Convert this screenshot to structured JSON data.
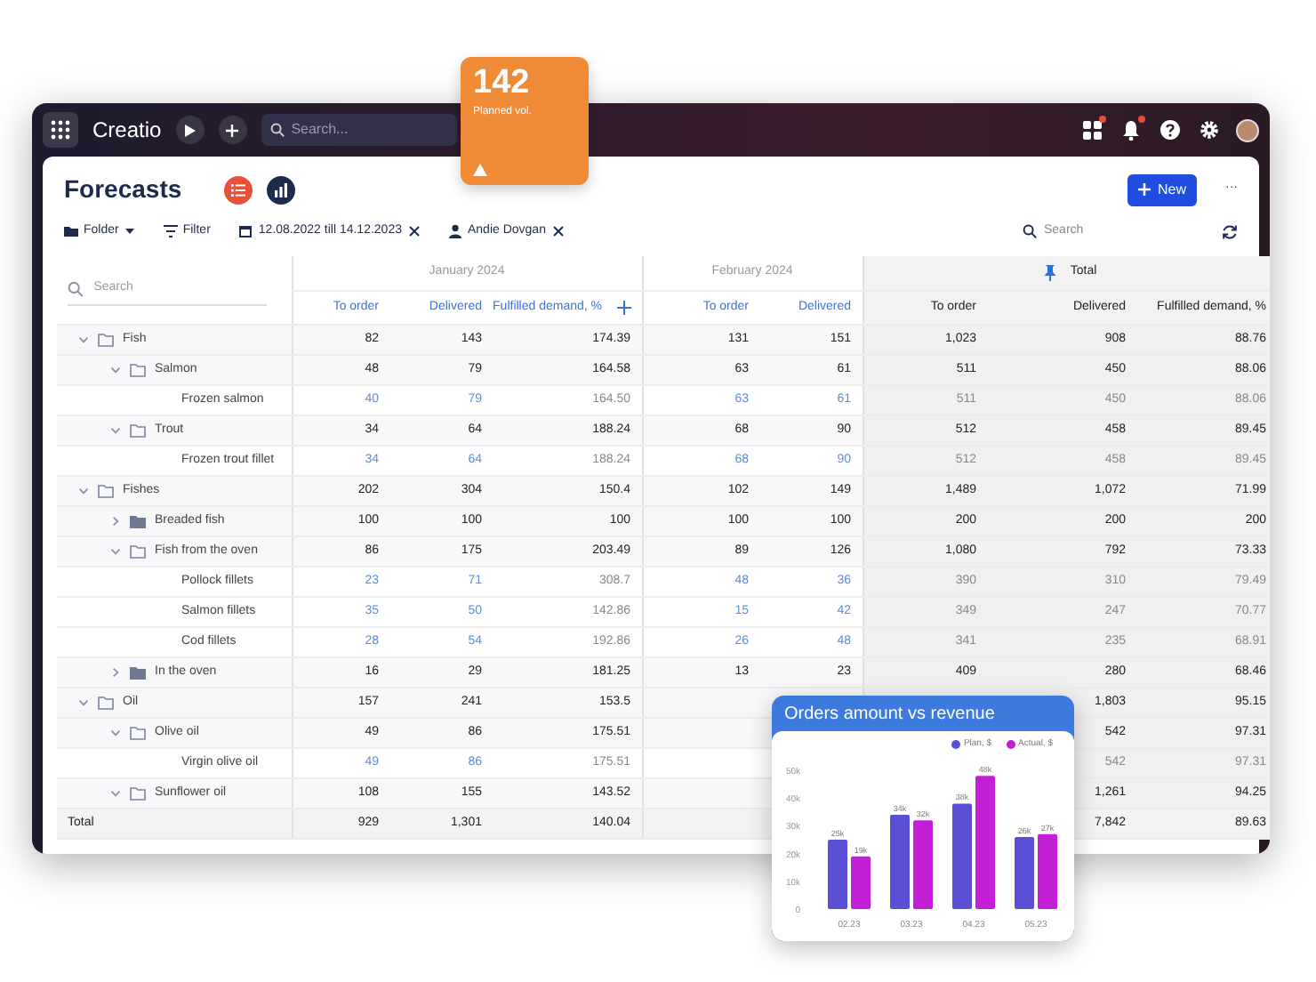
{
  "badge": {
    "value": "142",
    "label": "Planned vol."
  },
  "topbar": {
    "logo": "Creatio",
    "search_placeholder": "Search...",
    "notifications": [
      {
        "kind": "apps",
        "dot": true
      },
      {
        "kind": "bell",
        "dot": true
      },
      {
        "kind": "help",
        "dot": false
      },
      {
        "kind": "settings",
        "dot": false
      }
    ]
  },
  "header": {
    "title": "Forecasts",
    "views": [
      {
        "kind": "list",
        "selected": true
      },
      {
        "kind": "chart",
        "selected": false
      }
    ],
    "new_button": "New",
    "more": "···"
  },
  "filters": {
    "folder": "Folder",
    "filter": "Filter",
    "date_range": "12.08.2022 till 14.12.2023",
    "owner": "Andie Dovgan",
    "search_placeholder": "Search"
  },
  "table": {
    "search_placeholder": "Search",
    "groups": [
      {
        "title": "January 2024",
        "columns": [
          "To order",
          "Delivered",
          "Fulfilled demand, %"
        ],
        "kind": "period"
      },
      {
        "title": "February 2024",
        "columns": [
          "To order",
          "Delivered"
        ],
        "kind": "period"
      },
      {
        "title": "Total",
        "columns": [
          "To order",
          "Delivered",
          "Fulfilled demand, %"
        ],
        "kind": "total"
      }
    ],
    "rows": [
      {
        "name": "Fish",
        "kind": "group",
        "expanded": true,
        "values": {
          "jan_to_order": "82",
          "jan_delivered": "143",
          "jan_fulfilled": "174.39",
          "feb_to_order": "131",
          "feb_delivered": "151",
          "total_to_order": "1,023",
          "total_delivered": "908",
          "total_fulfilled": "88.76"
        },
        "children": [
          {
            "name": "Salmon",
            "kind": "group",
            "expanded": true,
            "values": {
              "jan_to_order": "48",
              "jan_delivered": "79",
              "jan_fulfilled": "164.58",
              "feb_to_order": "63",
              "feb_delivered": "61",
              "total_to_order": "511",
              "total_delivered": "450",
              "total_fulfilled": "88.06"
            },
            "children": [
              {
                "name": "Frozen salmon",
                "kind": "item",
                "values": {
                  "jan_to_order": "40",
                  "jan_delivered": "79",
                  "jan_fulfilled": "164.50",
                  "feb_to_order": "63",
                  "feb_delivered": "61",
                  "total_to_order": "511",
                  "total_delivered": "450",
                  "total_fulfilled": "88.06"
                }
              }
            ]
          },
          {
            "name": "Trout",
            "kind": "group",
            "expanded": true,
            "values": {
              "jan_to_order": "34",
              "jan_delivered": "64",
              "jan_fulfilled": "188.24",
              "feb_to_order": "68",
              "feb_delivered": "90",
              "total_to_order": "512",
              "total_delivered": "458",
              "total_fulfilled": "89.45"
            },
            "children": [
              {
                "name": "Frozen trout fillet",
                "kind": "item",
                "values": {
                  "jan_to_order": "34",
                  "jan_delivered": "64",
                  "jan_fulfilled": "188.24",
                  "feb_to_order": "68",
                  "feb_delivered": "90",
                  "total_to_order": "512",
                  "total_delivered": "458",
                  "total_fulfilled": "89.45"
                }
              }
            ]
          }
        ]
      },
      {
        "name": "Fishes",
        "kind": "group",
        "expanded": true,
        "values": {
          "jan_to_order": "202",
          "jan_delivered": "304",
          "jan_fulfilled": "150.4",
          "feb_to_order": "102",
          "feb_delivered": "149",
          "total_to_order": "1,489",
          "total_delivered": "1,072",
          "total_fulfilled": "71.99"
        },
        "children": [
          {
            "name": "Breaded fish",
            "kind": "group",
            "expanded": false,
            "values": {
              "jan_to_order": "100",
              "jan_delivered": "100",
              "jan_fulfilled": "100",
              "feb_to_order": "100",
              "feb_delivered": "100",
              "total_to_order": "200",
              "total_delivered": "200",
              "total_fulfilled": "200"
            }
          },
          {
            "name": "Fish from the oven",
            "kind": "group",
            "expanded": true,
            "values": {
              "jan_to_order": "86",
              "jan_delivered": "175",
              "jan_fulfilled": "203.49",
              "feb_to_order": "89",
              "feb_delivered": "126",
              "total_to_order": "1,080",
              "total_delivered": "792",
              "total_fulfilled": "73.33"
            },
            "children": [
              {
                "name": "Pollock fillets",
                "kind": "item",
                "values": {
                  "jan_to_order": "23",
                  "jan_delivered": "71",
                  "jan_fulfilled": "308.7",
                  "feb_to_order": "48",
                  "feb_delivered": "36",
                  "total_to_order": "390",
                  "total_delivered": "310",
                  "total_fulfilled": "79.49"
                }
              },
              {
                "name": "Salmon fillets",
                "kind": "item",
                "values": {
                  "jan_to_order": "35",
                  "jan_delivered": "50",
                  "jan_fulfilled": "142.86",
                  "feb_to_order": "15",
                  "feb_delivered": "42",
                  "total_to_order": "349",
                  "total_delivered": "247",
                  "total_fulfilled": "70.77"
                }
              },
              {
                "name": "Cod fillets",
                "kind": "item",
                "values": {
                  "jan_to_order": "28",
                  "jan_delivered": "54",
                  "jan_fulfilled": "192.86",
                  "feb_to_order": "26",
                  "feb_delivered": "48",
                  "total_to_order": "341",
                  "total_delivered": "235",
                  "total_fulfilled": "68.91"
                }
              }
            ]
          },
          {
            "name": "In the oven",
            "kind": "group",
            "expanded": false,
            "values": {
              "jan_to_order": "16",
              "jan_delivered": "29",
              "jan_fulfilled": "181.25",
              "feb_to_order": "13",
              "feb_delivered": "23",
              "total_to_order": "409",
              "total_delivered": "280",
              "total_fulfilled": "68.46"
            }
          }
        ]
      },
      {
        "name": "Oil",
        "kind": "group",
        "expanded": true,
        "values": {
          "jan_to_order": "157",
          "jan_delivered": "241",
          "jan_fulfilled": "153.5",
          "total_delivered": "1,803",
          "total_fulfilled": "95.15"
        },
        "children": [
          {
            "name": "Olive oil",
            "kind": "group",
            "expanded": true,
            "values": {
              "jan_to_order": "49",
              "jan_delivered": "86",
              "jan_fulfilled": "175.51",
              "total_delivered": "542",
              "total_fulfilled": "97.31"
            },
            "children": [
              {
                "name": "Virgin olive oil",
                "kind": "item",
                "values": {
                  "jan_to_order": "49",
                  "jan_delivered": "86",
                  "jan_fulfilled": "175.51",
                  "total_delivered": "542",
                  "total_fulfilled": "97.31"
                }
              }
            ]
          },
          {
            "name": "Sunflower oil",
            "kind": "group",
            "expanded": true,
            "values": {
              "jan_to_order": "108",
              "jan_delivered": "155",
              "jan_fulfilled": "143.52",
              "total_delivered": "1,261",
              "total_fulfilled": "94.25"
            }
          }
        ]
      }
    ],
    "total": {
      "label": "Total",
      "values": {
        "jan_to_order": "929",
        "jan_delivered": "1,301",
        "jan_fulfilled": "140.04",
        "total_delivered": "7,842",
        "total_fulfilled": "89.63"
      }
    }
  },
  "chart_popup": {
    "chart_data": {
      "type": "bar",
      "title": "Orders amount vs revenue",
      "categories": [
        "02.23",
        "03.23",
        "04.23",
        "05.23"
      ],
      "series": [
        {
          "name": "Plan, $",
          "color": "#5b4fd6",
          "values": [
            25,
            34,
            38,
            26
          ],
          "value_labels": [
            "25k",
            "34k",
            "38k",
            "26k"
          ]
        },
        {
          "name": "Actual, $",
          "color": "#c21fd6",
          "values": [
            19,
            32,
            48,
            27
          ],
          "value_labels": [
            "19k",
            "32k",
            "48k",
            "27k"
          ]
        }
      ],
      "yticks": [
        {
          "value": 0,
          "label": "0"
        },
        {
          "value": 10,
          "label": "10k"
        },
        {
          "value": 20,
          "label": "20k"
        },
        {
          "value": 30,
          "label": "30k"
        },
        {
          "value": 40,
          "label": "40k"
        },
        {
          "value": 50,
          "label": "50k"
        }
      ],
      "ylim": [
        0,
        50
      ],
      "data_labels": true
    }
  }
}
